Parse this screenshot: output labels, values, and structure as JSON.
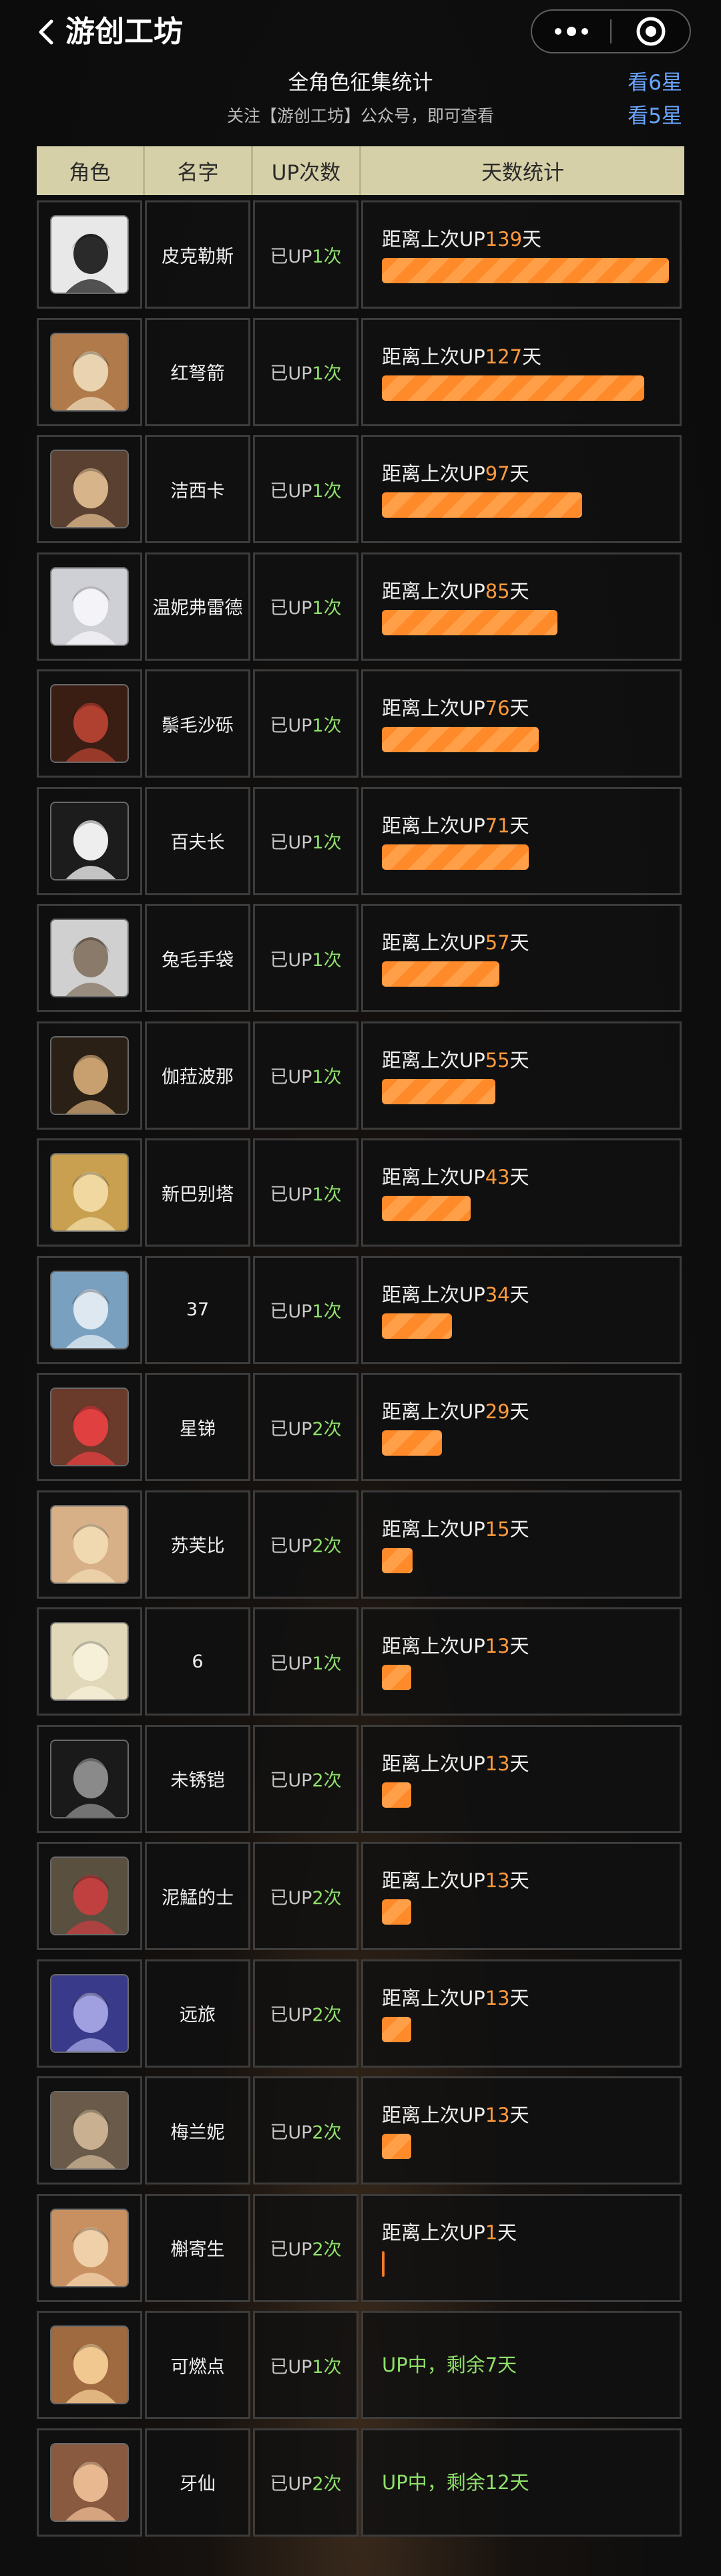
{
  "header": {
    "title": "游创工坊"
  },
  "summary": {
    "title": "全角色征集统计",
    "subtitle": "关注【游创工坊】公众号，即可查看",
    "link_6star": "看6星",
    "link_5star": "看5星"
  },
  "columns": [
    "角色",
    "名字",
    "UP次数",
    "天数统计"
  ],
  "strings": {
    "prefix": "已UP",
    "suffix": "次",
    "since": "距离上次UP",
    "day": "天"
  },
  "rows": [
    {
      "name": "皮克勒斯",
      "up": "1",
      "days": "139",
      "avatar_bg": "#e8e8e8",
      "avatar_fg": "#2a2a2a",
      "status": null
    },
    {
      "name": "红弩箭",
      "up": "1",
      "days": "127",
      "avatar_bg": "#b07a4a",
      "avatar_fg": "#e9d3b0",
      "status": null
    },
    {
      "name": "洁西卡",
      "up": "1",
      "days": "97",
      "avatar_bg": "#5a4030",
      "avatar_fg": "#d8b48a",
      "status": null
    },
    {
      "name": "温妮弗雷德",
      "up": "1",
      "days": "85",
      "avatar_bg": "#cfcfd6",
      "avatar_fg": "#f4f4f8",
      "status": null
    },
    {
      "name": "鬃毛沙砾",
      "up": "1",
      "days": "76",
      "avatar_bg": "#3a1e14",
      "avatar_fg": "#b04030",
      "status": null
    },
    {
      "name": "百夫长",
      "up": "1",
      "days": "71",
      "avatar_bg": "#1c1c1c",
      "avatar_fg": "#eeeeee",
      "status": null
    },
    {
      "name": "兔毛手袋",
      "up": "1",
      "days": "57",
      "avatar_bg": "#d0d0d0",
      "avatar_fg": "#8a7a6a",
      "status": null
    },
    {
      "name": "伽菈波那",
      "up": "1",
      "days": "55",
      "avatar_bg": "#2a2016",
      "avatar_fg": "#c8a070",
      "status": null
    },
    {
      "name": "新巴别塔",
      "up": "1",
      "days": "43",
      "avatar_bg": "#c8a050",
      "avatar_fg": "#f0d8a0",
      "status": null
    },
    {
      "name": "37",
      "up": "1",
      "days": "34",
      "avatar_bg": "#7aa0c0",
      "avatar_fg": "#dde8f0",
      "status": null
    },
    {
      "name": "星锑",
      "up": "2",
      "days": "29",
      "avatar_bg": "#6a3a2a",
      "avatar_fg": "#e04040",
      "status": null
    },
    {
      "name": "苏芙比",
      "up": "2",
      "days": "15",
      "avatar_bg": "#d8b088",
      "avatar_fg": "#f0d8b0",
      "status": null
    },
    {
      "name": "6",
      "up": "1",
      "days": "13",
      "avatar_bg": "#e0d8b8",
      "avatar_fg": "#f6f0d8",
      "status": null
    },
    {
      "name": "未锈铠",
      "up": "2",
      "days": "13",
      "avatar_bg": "#1a1a1a",
      "avatar_fg": "#8a8a8a",
      "status": null
    },
    {
      "name": "泥鯭的士",
      "up": "2",
      "days": "13",
      "avatar_bg": "#5a5040",
      "avatar_fg": "#c04040",
      "status": null
    },
    {
      "name": "远旅",
      "up": "2",
      "days": "13",
      "avatar_bg": "#3a3a8a",
      "avatar_fg": "#a0a0e0",
      "status": null
    },
    {
      "name": "梅兰妮",
      "up": "2",
      "days": "13",
      "avatar_bg": "#6a5a4a",
      "avatar_fg": "#c8b090",
      "status": null
    },
    {
      "name": "槲寄生",
      "up": "2",
      "days": "1",
      "avatar_bg": "#c89060",
      "avatar_fg": "#f0d0a8",
      "status": null
    },
    {
      "name": "可燃点",
      "up": "1",
      "days": null,
      "avatar_bg": "#a06a40",
      "avatar_fg": "#f0c890",
      "status": "UP中，剩余7天"
    },
    {
      "name": "牙仙",
      "up": "2",
      "days": null,
      "avatar_bg": "#8a5a40",
      "avatar_fg": "#e8b890",
      "status": "UP中，剩余12天"
    }
  ],
  "colors": {
    "accent_orange": "#ff8a2a",
    "accent_green": "#8ee06a",
    "link_blue": "#6aa5ff",
    "header_bg": "#d6d0a8"
  },
  "max_days": 139
}
